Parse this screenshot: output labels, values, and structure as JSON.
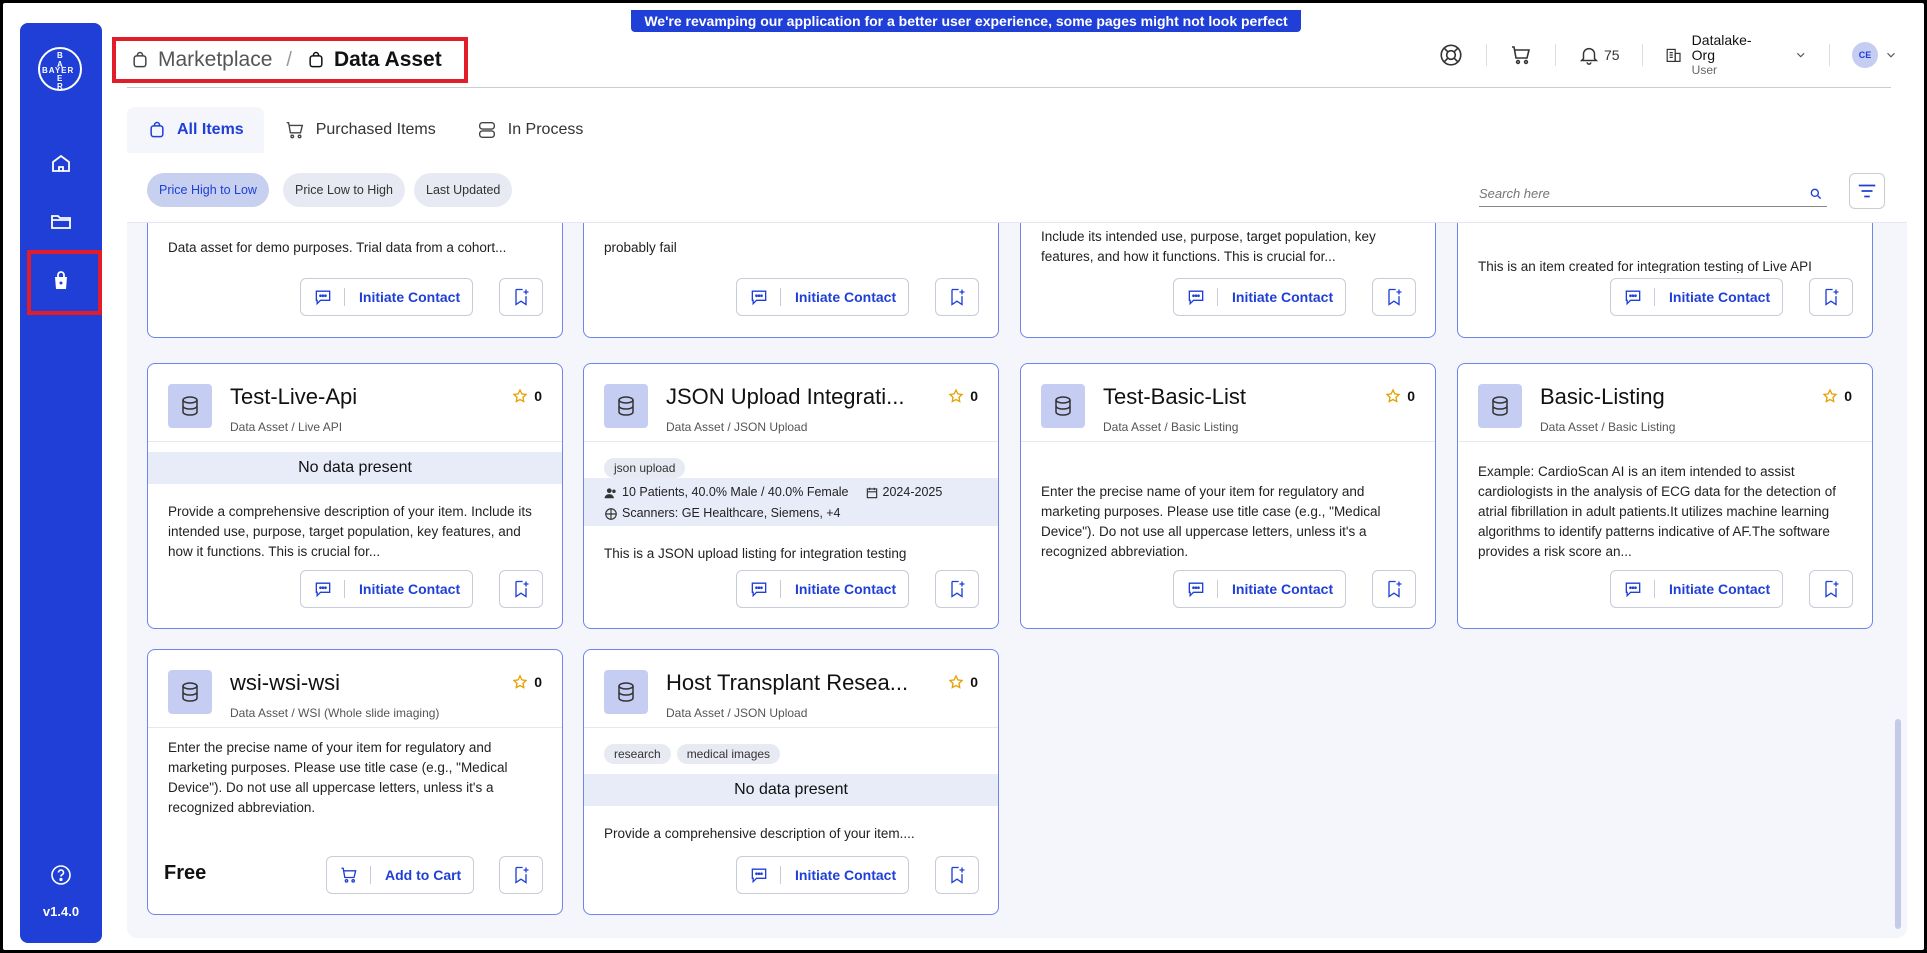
{
  "banner": "We're revamping our application for a better user experience, some pages might not look perfect yet!",
  "rail": {
    "logo": "BAYER",
    "version": "v1.4.0"
  },
  "breadcrumb": {
    "parent": "Marketplace",
    "separator": "/",
    "current": "Data Asset"
  },
  "topbar": {
    "notifications_count": "75",
    "org_name": "Datalake-Org",
    "org_role": "User",
    "avatar_initials": "CE"
  },
  "tabs": [
    {
      "label": "All Items"
    },
    {
      "label": "Purchased Items"
    },
    {
      "label": "In Process"
    }
  ],
  "sort": [
    "Price High to Low",
    "Price Low to High",
    "Last Updated"
  ],
  "search": {
    "placeholder": "Search here"
  },
  "labels": {
    "initiate_contact": "Initiate Contact",
    "add_to_cart": "Add to Cart",
    "no_data": "No data present"
  },
  "partial_cards": [
    {
      "desc": "Data asset for demo purposes. Trial data from a cohort..."
    },
    {
      "desc": "probably fail"
    },
    {
      "desc": "Include its intended use, purpose, target population, key features, and how it functions. This is crucial for..."
    },
    {
      "desc": "This is an item created for integration testing of Live API"
    }
  ],
  "cards": [
    {
      "title": "Test-Live-Api",
      "subtitle": "Data Asset / Live API",
      "rating": "0",
      "desc": "Provide a comprehensive description of your item. Include its intended use, purpose, target population, key features, and how it functions. This is crucial for..."
    },
    {
      "title": "JSON Upload Integrati...",
      "subtitle": "Data Asset / JSON Upload",
      "rating": "0",
      "tags": [
        "json upload"
      ],
      "meta_patients": "10 Patients, 40.0% Male / 40.0% Female",
      "meta_years": "2024-2025",
      "meta_scanners": "Scanners: GE Healthcare, Siemens, +4",
      "desc": "This is a JSON upload listing for integration testing"
    },
    {
      "title": "Test-Basic-List",
      "subtitle": "Data Asset / Basic Listing",
      "rating": "0",
      "desc": "Enter the precise name of your item for regulatory and marketing purposes. Please use title case (e.g., \"Medical Device\"). Do not use all uppercase letters, unless it's a recognized abbreviation."
    },
    {
      "title": "Basic-Listing",
      "subtitle": "Data Asset / Basic Listing",
      "rating": "0",
      "desc": "Example: CardioScan AI is an item intended to assist cardiologists in the analysis of ECG data for the detection of atrial fibrillation in adult patients.It utilizes machine learning algorithms to identify patterns indicative of AF.The software provides a risk score an..."
    },
    {
      "title": "wsi-wsi-wsi",
      "subtitle": "Data Asset / WSI (Whole slide imaging)",
      "rating": "0",
      "desc": "Enter the precise name of your item for regulatory and marketing purposes. Please use title case (e.g., \"Medical Device\"). Do not use all uppercase letters, unless it's a recognized abbreviation.",
      "price": "Free"
    },
    {
      "title": "Host Transplant Resea...",
      "subtitle": "Data Asset / JSON Upload",
      "rating": "0",
      "tags": [
        "research",
        "medical images"
      ],
      "desc": "Provide a comprehensive description of your item...."
    }
  ]
}
